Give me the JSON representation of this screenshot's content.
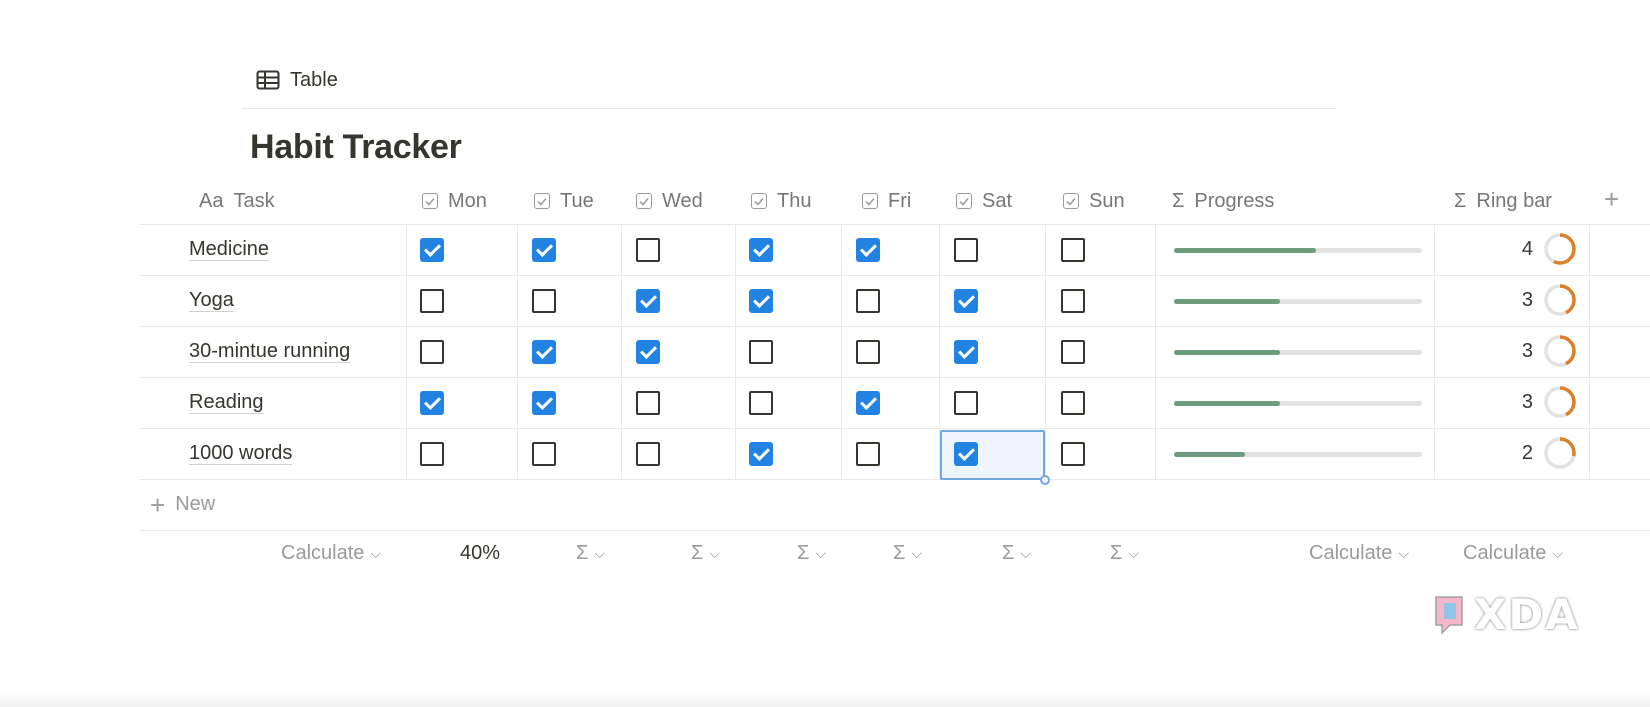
{
  "view_tab": {
    "label": "Table",
    "icon": "table-icon"
  },
  "title": "Habit Tracker",
  "columns": {
    "task": {
      "prefix": "Aa",
      "label": "Task"
    },
    "days": [
      "Mon",
      "Tue",
      "Wed",
      "Thu",
      "Fri",
      "Sat",
      "Sun"
    ],
    "progress": {
      "prefix": "Σ",
      "label": "Progress"
    },
    "ring": {
      "prefix": "Σ",
      "label": "Ring bar"
    },
    "add_icon": "plus-icon"
  },
  "rows": [
    {
      "task": "Medicine",
      "checks": [
        true,
        true,
        false,
        true,
        true,
        false,
        false
      ],
      "ring_value": "4",
      "progress": 0.571
    },
    {
      "task": "Yoga",
      "checks": [
        false,
        false,
        true,
        true,
        false,
        true,
        false
      ],
      "ring_value": "3",
      "progress": 0.429
    },
    {
      "task": "30-mintue running",
      "checks": [
        false,
        true,
        true,
        false,
        false,
        true,
        false
      ],
      "ring_value": "3",
      "progress": 0.429
    },
    {
      "task": "Reading",
      "checks": [
        true,
        true,
        false,
        false,
        true,
        false,
        false
      ],
      "ring_value": "3",
      "progress": 0.429
    },
    {
      "task": "1000 words",
      "checks": [
        false,
        false,
        false,
        true,
        false,
        true,
        false
      ],
      "ring_value": "2",
      "progress": 0.286
    }
  ],
  "new_row": {
    "label": "New"
  },
  "footer": {
    "task_calc": "Calculate",
    "mon_calc": "40%",
    "sigma": "Σ",
    "progress_calc": "Calculate",
    "ring_calc": "Calculate"
  },
  "watermark": "XDA",
  "colors": {
    "checkbox_checked": "#2383e2",
    "progress_fill": "#6c9b7d",
    "ring_fill": "#d9822b",
    "selection": "#6ea8e5"
  }
}
